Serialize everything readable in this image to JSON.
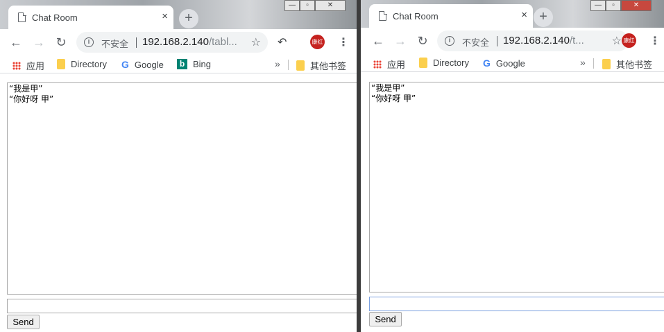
{
  "windows": [
    {
      "tab_title": "Chat Room",
      "url_security": "不安全",
      "url_host": "192.168.2.140",
      "url_rest": "/tabl...",
      "bookmarks": [
        {
          "label": "应用",
          "icon": "apps-icon"
        },
        {
          "label": "Directory",
          "icon": "folder-icon"
        },
        {
          "label": "Google",
          "icon": "google-icon"
        },
        {
          "label": "Bing",
          "icon": "bing-icon"
        }
      ],
      "other_bookmarks": "其他书签",
      "avatar": "康红",
      "messages": [
        "“我是甲”",
        "“你好呀 甲”"
      ],
      "input_value": "",
      "send_label": "Send"
    },
    {
      "tab_title": "Chat Room",
      "url_security": "不安全",
      "url_host": "192.168.2.140",
      "url_rest": "/t...",
      "bookmarks": [
        {
          "label": "应用",
          "icon": "apps-icon"
        },
        {
          "label": "Directory",
          "icon": "folder-icon"
        },
        {
          "label": "Google",
          "icon": "google-icon"
        }
      ],
      "other_bookmarks": "其他书签",
      "avatar": "康红",
      "messages": [
        "“我是甲”",
        "“你好呀 甲”"
      ],
      "input_value": "",
      "send_label": "Send"
    }
  ],
  "icons": {
    "close": "×",
    "new_tab": "+",
    "back": "←",
    "forward": "→",
    "reload": "↻",
    "star": "☆",
    "menu": "⋮",
    "more": "»",
    "info": "i"
  }
}
